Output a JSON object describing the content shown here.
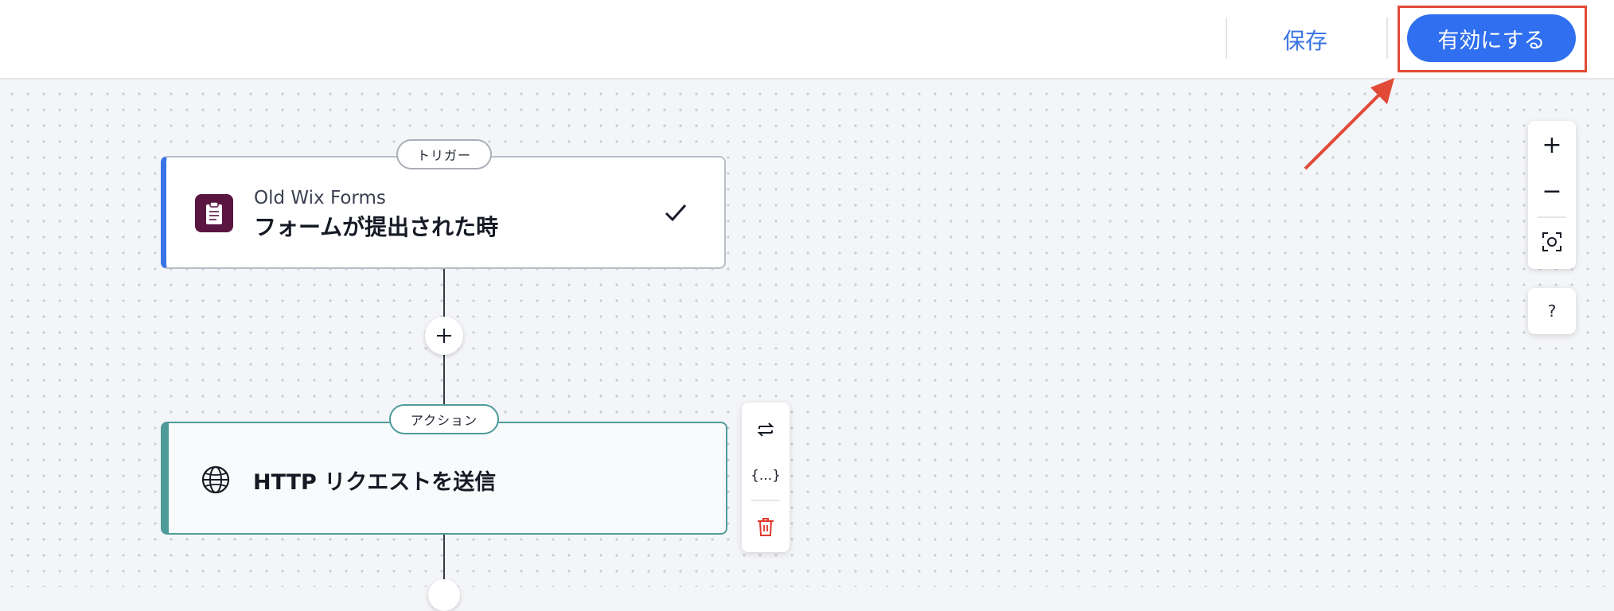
{
  "topbar": {
    "save_label": "保存",
    "activate_label": "有効にする",
    "colors": {
      "primary": "#2f6ff0",
      "highlight": "#e04a36"
    }
  },
  "trigger": {
    "pill": "トリガー",
    "app_name": "Old Wix Forms",
    "title": "フォームが提出された時",
    "icon": "clipboard-icon",
    "status_icon": "check-icon"
  },
  "action": {
    "pill": "アクション",
    "title": "HTTP リクエストを送信",
    "icon": "globe-icon"
  },
  "action_toolbar": {
    "icons": [
      "swap-icon",
      "variables-icon",
      "trash-icon"
    ],
    "variables_glyph": "{...}"
  },
  "zoom_controls": {
    "zoom_in": "+",
    "zoom_out": "−",
    "fit_icon": "fit-to-screen-icon",
    "help": "?"
  }
}
